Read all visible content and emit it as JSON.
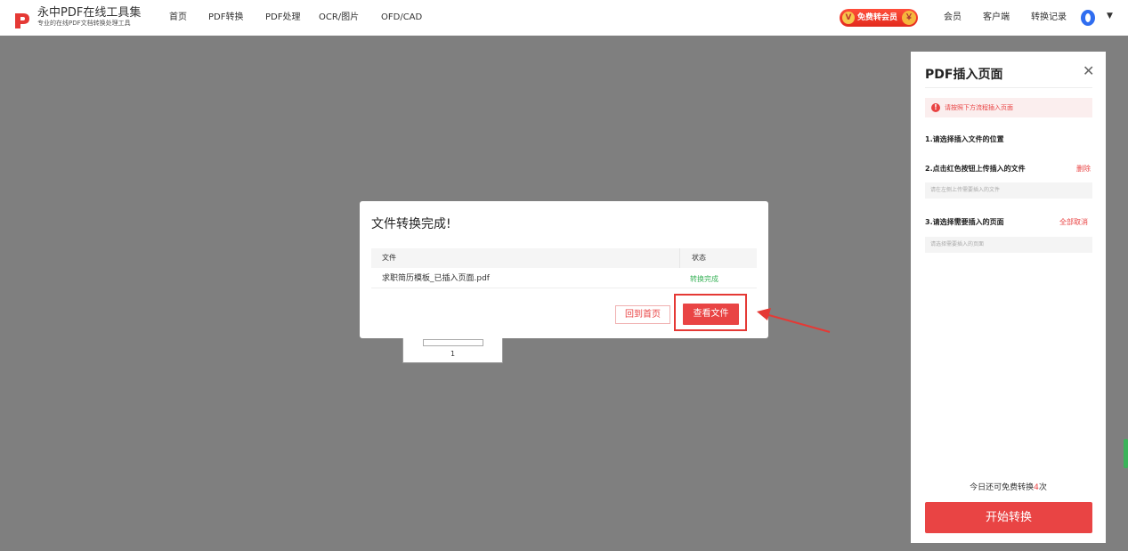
{
  "header": {
    "logo_title": "永中PDF在线工具集",
    "logo_subtitle": "专业的在线PDF文档转换处理工具",
    "nav": [
      "首页",
      "PDF转换",
      "PDF处理",
      "OCR/图片",
      "OFD/CAD"
    ],
    "vip_label": "免费转会员",
    "right_links": [
      "会员",
      "客户端",
      "转换记录"
    ]
  },
  "panel": {
    "title": "PDF插入页面",
    "alert": "请按照下方流程插入页面",
    "step1": "1.请选择插入文件的位置",
    "step2": "2.点击红色按钮上传插入的文件",
    "step2_action": "删除",
    "step2_placeholder": "请在左侧上传需要插入的文件",
    "step3": "3.请选择需要插入的页面",
    "step3_action": "全部取消",
    "step3_placeholder": "请选择需要插入的页面",
    "remaining_prefix": "今日还可免费转换",
    "remaining_count": "4",
    "remaining_suffix": "次",
    "start_button": "开始转换"
  },
  "document": {
    "page_number": "1"
  },
  "modal": {
    "title": "文件转换完成!",
    "columns": {
      "file": "文件",
      "status": "状态"
    },
    "row": {
      "file": "求职简历模板_已插入页面.pdf",
      "status": "转换完成"
    },
    "home_button": "回到首页",
    "view_button": "查看文件"
  },
  "colors": {
    "accent": "#e94444",
    "success": "#3bb35a",
    "overlay": "#7f7f7f"
  }
}
